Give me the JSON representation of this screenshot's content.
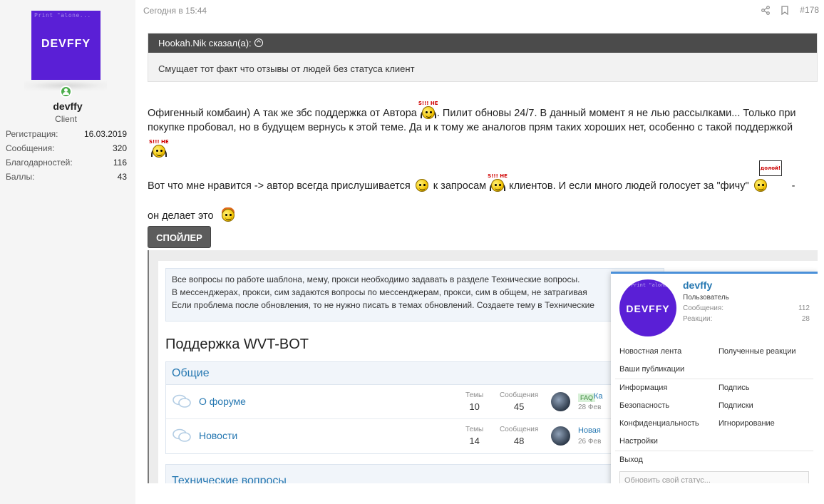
{
  "user": {
    "avatar_text": "DEVFFY",
    "avatar_top_text": "Print \"alone...",
    "name": "devffy",
    "title": "Client",
    "stats": [
      {
        "label": "Регистрация:",
        "value": "16.03.2019"
      },
      {
        "label": "Сообщения:",
        "value": "320"
      },
      {
        "label": "Благодарностей:",
        "value": "116"
      },
      {
        "label": "Баллы:",
        "value": "43"
      }
    ]
  },
  "post": {
    "date": "Сегодня в 15:44",
    "number": "#178",
    "quote": {
      "author": "Hookah.Nik сказал(а):",
      "text": "Смущает тот факт что отзывы от людей без статуса клиент"
    },
    "p1": {
      "a": "Офигенный комбаин) А так же збс поддержка от Автора",
      "b": ". Пилит обновы 24/7. В данный момент я не лью рассылками... Только при",
      "c": "покупке пробовал, но в будущем вернусь к этой теме. Да и к тому же аналогов прям таких хороших нет, особенно с такой поддержкой"
    },
    "p2": {
      "a": "Вот что мне нравится -> автор всегда прислушивается",
      "b": " к запросам",
      "c": " клиентов. И если много людей голосует за \"фичу\"",
      "d": " -",
      "e": "он делает это"
    },
    "smile_sign": "S!!! НЕ",
    "smile_sign2": "долой!",
    "spoiler_label": "СПОЙЛЕР"
  },
  "screenshot": {
    "notice": [
      "Все вопросы по работе шаблона, мему, прокси необходимо задавать в разделе Технические вопросы.",
      "В мессенджерах, прокси, сим задаются вопросы по мессенджерам, прокси, сим в общем, не затрагивая",
      "Если проблема после обновления, то не нужно писать в темах обновлений. Создаете тему в Технические"
    ],
    "forum_title": "Поддержка WVT-BOT",
    "category": "Общие",
    "forums": [
      {
        "name": "О форуме",
        "threads_label": "Темы",
        "threads": "10",
        "posts_label": "Сообщения",
        "posts": "45",
        "badge": "FAQ",
        "last": "Ка",
        "date": "28 Фев"
      },
      {
        "name": "Новости",
        "threads_label": "Темы",
        "threads": "14",
        "posts_label": "Сообщения",
        "posts": "48",
        "badge": "",
        "last": "Новая",
        "date": "26 Фев"
      }
    ],
    "category2": "Технические вопросы",
    "menu": {
      "name": "devffy",
      "role": "Пользователь",
      "stats": [
        {
          "label": "Сообщения:",
          "value": "112"
        },
        {
          "label": "Реакции:",
          "value": "28"
        }
      ],
      "links": [
        [
          "Новостная лента",
          "Полученные реакции"
        ],
        [
          "Ваши публикации",
          ""
        ],
        [
          "Информация",
          "Подпись"
        ],
        [
          "Безопасность",
          "Подписки"
        ],
        [
          "Конфиденциальность",
          "Игнорирование"
        ],
        [
          "Настройки",
          ""
        ],
        [
          "Выход",
          ""
        ]
      ],
      "status_placeholder": "Обновить свой статус..."
    }
  },
  "colors": {
    "accent": "#2577b1",
    "avatar": "#5a1fd6",
    "quote_head": "#4b4b4b",
    "online": "#4cae4c"
  }
}
